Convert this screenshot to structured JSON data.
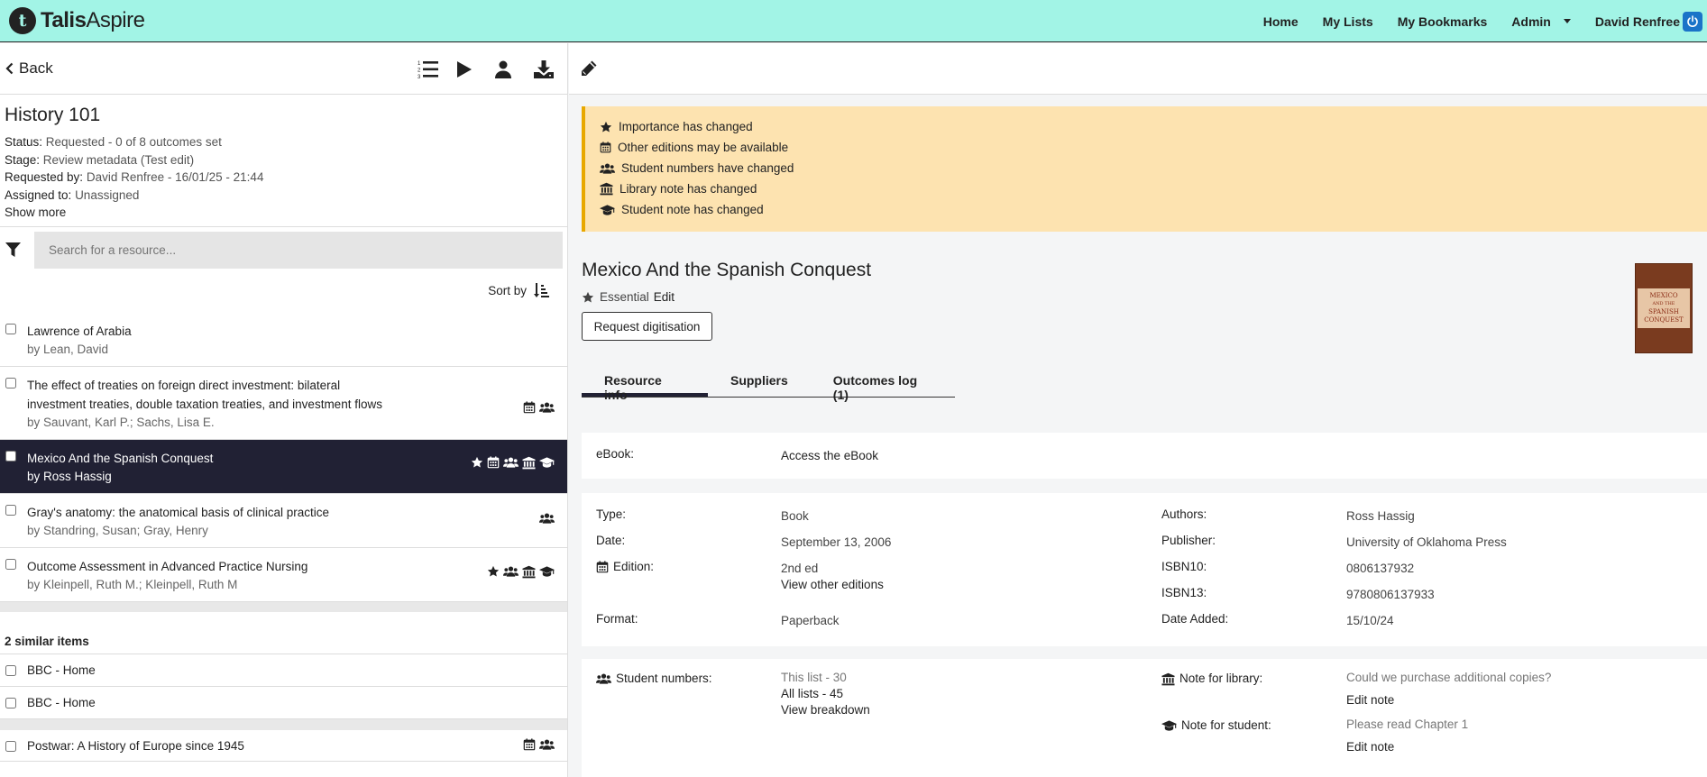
{
  "app": {
    "logo_bold": "Talis",
    "logo_light": "Aspire",
    "logo_glyph": "t"
  },
  "nav": {
    "home": "Home",
    "my_lists": "My Lists",
    "my_bookmarks": "My Bookmarks",
    "admin": "Admin",
    "user": "David Renfree"
  },
  "toolbar": {
    "back": "Back"
  },
  "list": {
    "title": "History 101",
    "status_label": "Status:",
    "status_value": "Requested - 0 of 8 outcomes set",
    "stage_label": "Stage:",
    "stage_value": "Review metadata (Test edit)",
    "requested_label": "Requested by:",
    "requested_value": "David Renfree - 16/01/25 - 21:44",
    "assigned_label": "Assigned to:",
    "assigned_value": "Unassigned",
    "show_more": "Show more"
  },
  "search": {
    "placeholder": "Search for a resource..."
  },
  "sort": {
    "label": "Sort by"
  },
  "items": [
    {
      "title": "Lawrence of Arabia",
      "author": "by Lean, David"
    },
    {
      "title": "The effect of treaties on foreign direct investment: bilateral investment treaties, double taxation treaties, and investment flows",
      "author": "by Sauvant, Karl P.; Sachs, Lisa E."
    },
    {
      "title": "Mexico And the Spanish Conquest",
      "author": "by Ross Hassig"
    },
    {
      "title": "Gray's anatomy: the anatomical basis of clinical practice",
      "author": "by Standring, Susan; Gray, Henry"
    },
    {
      "title": "Outcome Assessment in Advanced Practice Nursing",
      "author": "by Kleinpell, Ruth M.; Kleinpell, Ruth M"
    }
  ],
  "similar": {
    "heading": "2 similar items",
    "items": [
      "BBC - Home",
      "BBC - Home"
    ]
  },
  "extra_item": {
    "title": "Postwar: A History of Europe since 1945"
  },
  "alerts": [
    "Importance has changed",
    "Other editions may be available",
    "Student numbers have changed",
    "Library note has changed",
    "Student note has changed"
  ],
  "resource": {
    "title": "Mexico And the Spanish Conquest",
    "importance": "Essential",
    "importance_edit": "Edit",
    "request_digitisation": "Request digitisation",
    "cover_line1": "MEXICO",
    "cover_line2": "AND THE",
    "cover_line3": "SPANISH",
    "cover_line4": "CONQUEST"
  },
  "tabs": [
    "Resource info",
    "Suppliers",
    "Outcomes log (1)"
  ],
  "ebook": {
    "label": "eBook:",
    "link": "Access the eBook"
  },
  "details": {
    "type_label": "Type:",
    "type_value": "Book",
    "date_label": "Date:",
    "date_value": "September 13, 2006",
    "edition_label": "Edition:",
    "edition_value": "2nd ed",
    "edition_link": "View other editions",
    "format_label": "Format:",
    "format_value": "Paperback",
    "authors_label": "Authors:",
    "authors_value": "Ross Hassig",
    "publisher_label": "Publisher:",
    "publisher_value": "University of Oklahoma Press",
    "isbn10_label": "ISBN10:",
    "isbn10_value": "0806137932",
    "isbn13_label": "ISBN13:",
    "isbn13_value": "9780806137933",
    "date_added_label": "Date Added:",
    "date_added_value": "15/10/24"
  },
  "students": {
    "label": "Student numbers:",
    "this_list": "This list - 30",
    "all_lists": "All lists - 45",
    "breakdown": "View breakdown",
    "library_label": "Note for library:",
    "library_note": "Could we purchase additional copies?",
    "library_edit": "Edit note",
    "student_label": "Note for student:",
    "student_note": "Please read Chapter 1",
    "student_edit": "Edit note"
  }
}
